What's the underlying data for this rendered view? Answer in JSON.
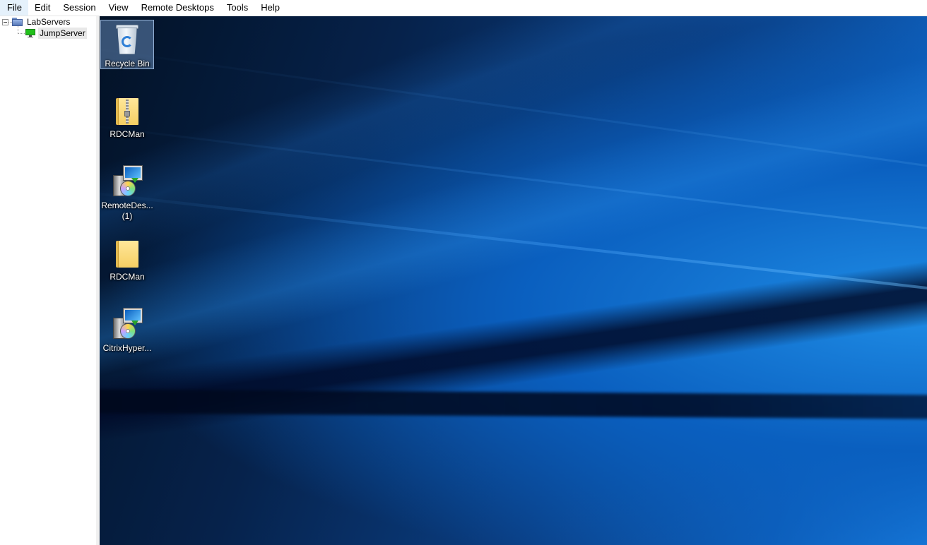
{
  "menu": [
    "File",
    "Edit",
    "Session",
    "View",
    "Remote Desktops",
    "Tools",
    "Help"
  ],
  "tree": {
    "group_label": "LabServers",
    "server_label": "JumpServer"
  },
  "desktop": {
    "icons": [
      {
        "label": "Recycle Bin",
        "icon": "recycle-bin-icon",
        "selected": true
      },
      {
        "label": "RDCMan",
        "icon": "zip-folder-icon"
      },
      {
        "label": "RemoteDes...",
        "label2": "(1)",
        "icon": "installer-icon"
      },
      {
        "label": "RDCMan",
        "icon": "folder-icon"
      },
      {
        "label": "CitrixHyper...",
        "icon": "installer-icon"
      }
    ]
  },
  "colors": {
    "desktop_dark": "#031226",
    "desktop_bright": "#1a7fe0",
    "server_status": "#22c11b"
  }
}
